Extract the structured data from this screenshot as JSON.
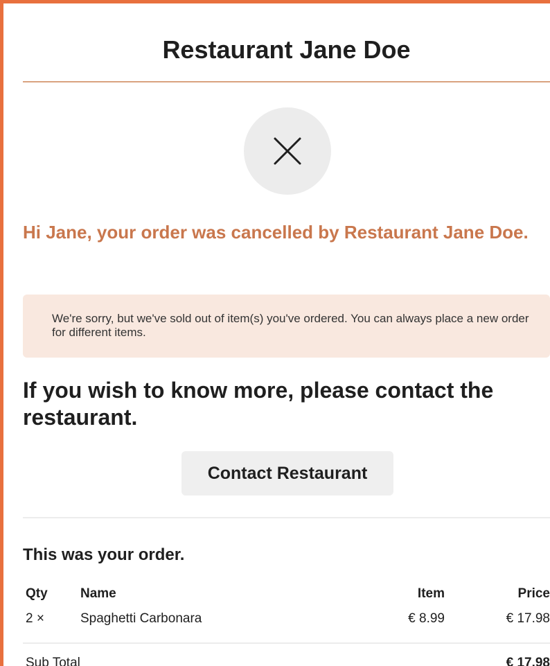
{
  "header": {
    "title": "Restaurant Jane Doe"
  },
  "status": {
    "icon": "close-icon",
    "greeting": "Hi Jane, your order was cancelled by Restaurant Jane Doe.",
    "notice": "We're sorry, but we've sold out of item(s) you've ordered. You can always place a new order for different items."
  },
  "contact": {
    "heading": "If you wish to know more, please contact the restaurant.",
    "button_label": "Contact Restaurant"
  },
  "order": {
    "heading": "This was your order.",
    "columns": {
      "qty": "Qty",
      "name": "Name",
      "item": "Item",
      "price": "Price"
    },
    "items": [
      {
        "qty": "2 ×",
        "name": "Spaghetti Carbonara",
        "item_price": "€ 8.99",
        "price": "€ 17.98"
      }
    ],
    "subtotal_label": "Sub Total",
    "subtotal_value": "€ 17.98"
  },
  "colors": {
    "accent_border": "#e8703e",
    "greeting_text": "#c9774d",
    "notice_background": "#f9e8df",
    "button_background": "#efefef"
  }
}
